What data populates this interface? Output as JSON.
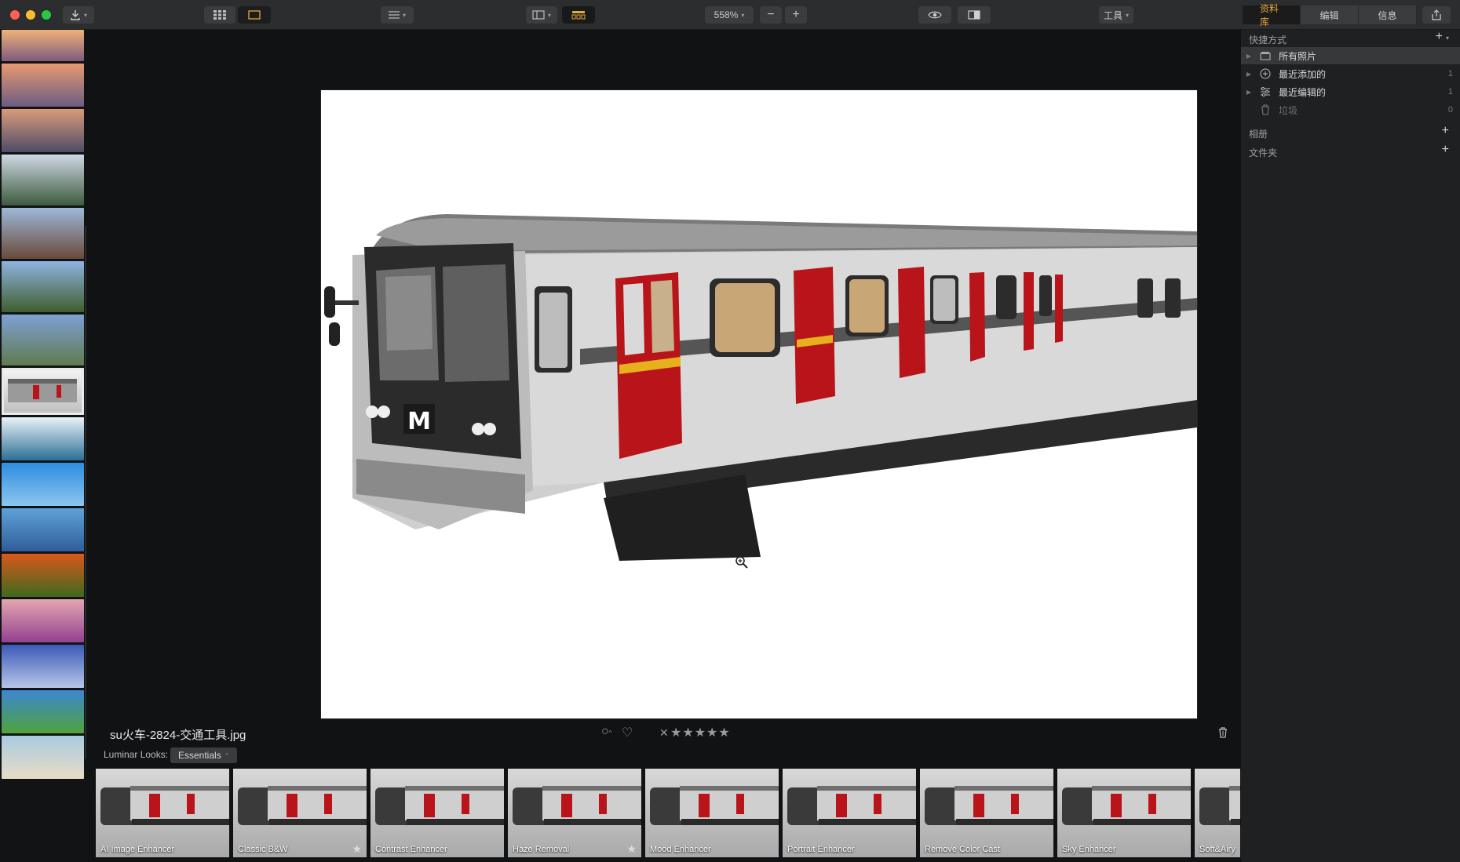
{
  "toolbar": {
    "zoom_label": "558%",
    "zoom_minus": "−",
    "zoom_plus": "+",
    "tools_label": "工具",
    "tabs": [
      {
        "label": "资料库",
        "active": true
      },
      {
        "label": "编辑",
        "active": false
      },
      {
        "label": "信息",
        "active": false
      }
    ]
  },
  "filmstrip": {
    "thumbnails": [
      {
        "name": "sunset-lake-1",
        "colors": [
          "#f0b27a",
          "#7e5a7d"
        ]
      },
      {
        "name": "sunset-lake-2",
        "colors": [
          "#e79a6f",
          "#6b5c84"
        ]
      },
      {
        "name": "sunset-lake-3",
        "colors": [
          "#d99b79",
          "#4e4c68"
        ]
      },
      {
        "name": "canal-boats",
        "colors": [
          "#cfd8e3",
          "#3d5a3f"
        ]
      },
      {
        "name": "canal-houses",
        "colors": [
          "#9db8d8",
          "#6a4a3a"
        ]
      },
      {
        "name": "canal-trees",
        "colors": [
          "#8fb3e0",
          "#3f5e2e"
        ]
      },
      {
        "name": "river-town",
        "colors": [
          "#7ea1d4",
          "#5f7a4e"
        ]
      },
      {
        "name": "train-selected",
        "colors": [
          "#f5f5f5",
          "#bdbdbd"
        ]
      },
      {
        "name": "surf-wave",
        "colors": [
          "#e9f2f8",
          "#2c6f95"
        ]
      },
      {
        "name": "dandelions",
        "colors": [
          "#2d8de0",
          "#8cc6ef"
        ]
      },
      {
        "name": "lake-reflection",
        "colors": [
          "#5fa1d9",
          "#2f5e99"
        ]
      },
      {
        "name": "field-sunset",
        "colors": [
          "#d9581c",
          "#3e6a1d"
        ]
      },
      {
        "name": "lavender-field",
        "colors": [
          "#e3a6b0",
          "#94418f"
        ]
      },
      {
        "name": "mountain-lake",
        "colors": [
          "#3b59b7",
          "#b7c6e8"
        ]
      },
      {
        "name": "green-meadow",
        "colors": [
          "#3d86d3",
          "#4fa33a"
        ]
      },
      {
        "name": "beach",
        "colors": [
          "#a9cbe0",
          "#e8dcc5"
        ]
      }
    ]
  },
  "photo": {
    "train_logo": "M"
  },
  "info": {
    "filename": "su火车-2824-交通工具.jpg",
    "stars": "★★★★★",
    "reject": "✕",
    "heart": "♡",
    "circle": "○"
  },
  "looks": {
    "label": "Luminar Looks:",
    "dropdown": "Essentials",
    "items": [
      {
        "name": "AI Image Enhancer",
        "star": false
      },
      {
        "name": "Classic B&W",
        "star": true
      },
      {
        "name": "Contrast Enhancer",
        "star": false
      },
      {
        "name": "Haze Removal",
        "star": true
      },
      {
        "name": "Mood Enhancer",
        "star": false
      },
      {
        "name": "Portrait Enhancer",
        "star": false
      },
      {
        "name": "Remove Color Cast",
        "star": false
      },
      {
        "name": "Sky Enhancer",
        "star": false
      },
      {
        "name": "Soft&Airy",
        "star": false
      }
    ]
  },
  "panel": {
    "shortcuts_label": "快捷方式",
    "rows": [
      {
        "label": "所有照片",
        "count": "",
        "active": true,
        "icon": "folder-icon"
      },
      {
        "label": "最近添加的",
        "count": "1",
        "active": false,
        "icon": "add-circle-icon"
      },
      {
        "label": "最近编辑的",
        "count": "1",
        "active": false,
        "icon": "sliders-icon"
      },
      {
        "label": "垃圾",
        "count": "0",
        "active": false,
        "icon": "trash-icon"
      }
    ],
    "albums_label": "相册",
    "folders_label": "文件夹",
    "plus": "+"
  },
  "colors": {
    "accent": "#e9a83b",
    "toolbar": "#2c2d2f",
    "panel": "#1f2021",
    "background": "#111213"
  }
}
